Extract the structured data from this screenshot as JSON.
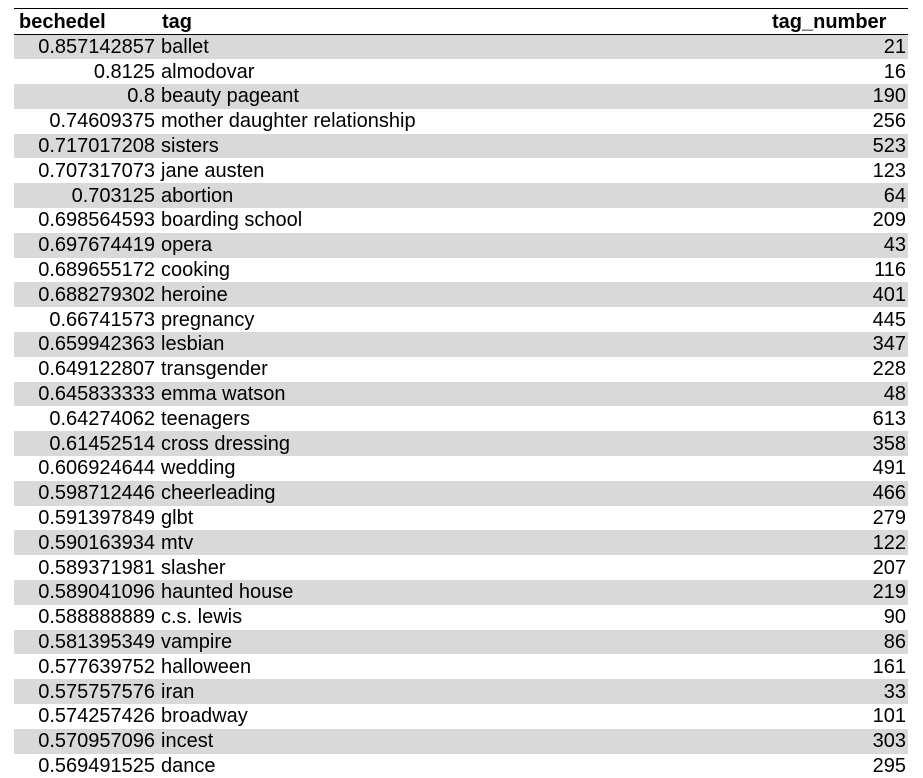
{
  "columns": {
    "bechedel": "bechedel",
    "tag": "tag",
    "tag_number": "tag_number"
  },
  "rows": [
    {
      "bechedel": "0.857142857",
      "tag": "ballet",
      "tag_number": "21"
    },
    {
      "bechedel": "0.8125",
      "tag": "almodovar",
      "tag_number": "16"
    },
    {
      "bechedel": "0.8",
      "tag": "beauty pageant",
      "tag_number": "190"
    },
    {
      "bechedel": "0.74609375",
      "tag": "mother daughter relationship",
      "tag_number": "256"
    },
    {
      "bechedel": "0.717017208",
      "tag": "sisters",
      "tag_number": "523"
    },
    {
      "bechedel": "0.707317073",
      "tag": "jane austen",
      "tag_number": "123"
    },
    {
      "bechedel": "0.703125",
      "tag": "abortion",
      "tag_number": "64"
    },
    {
      "bechedel": "0.698564593",
      "tag": "boarding school",
      "tag_number": "209"
    },
    {
      "bechedel": "0.697674419",
      "tag": "opera",
      "tag_number": "43"
    },
    {
      "bechedel": "0.689655172",
      "tag": "cooking",
      "tag_number": "116"
    },
    {
      "bechedel": "0.688279302",
      "tag": "heroine",
      "tag_number": "401"
    },
    {
      "bechedel": "0.66741573",
      "tag": "pregnancy",
      "tag_number": "445"
    },
    {
      "bechedel": "0.659942363",
      "tag": "lesbian",
      "tag_number": "347"
    },
    {
      "bechedel": "0.649122807",
      "tag": "transgender",
      "tag_number": "228"
    },
    {
      "bechedel": "0.645833333",
      "tag": "emma watson",
      "tag_number": "48"
    },
    {
      "bechedel": "0.64274062",
      "tag": "teenagers",
      "tag_number": "613"
    },
    {
      "bechedel": "0.61452514",
      "tag": "cross dressing",
      "tag_number": "358"
    },
    {
      "bechedel": "0.606924644",
      "tag": "wedding",
      "tag_number": "491"
    },
    {
      "bechedel": "0.598712446",
      "tag": "cheerleading",
      "tag_number": "466"
    },
    {
      "bechedel": "0.591397849",
      "tag": "glbt",
      "tag_number": "279"
    },
    {
      "bechedel": "0.590163934",
      "tag": "mtv",
      "tag_number": "122"
    },
    {
      "bechedel": "0.589371981",
      "tag": "slasher",
      "tag_number": "207"
    },
    {
      "bechedel": "0.589041096",
      "tag": "haunted house",
      "tag_number": "219"
    },
    {
      "bechedel": "0.588888889",
      "tag": "c.s. lewis",
      "tag_number": "90"
    },
    {
      "bechedel": "0.581395349",
      "tag": "vampire",
      "tag_number": "86"
    },
    {
      "bechedel": "0.577639752",
      "tag": "halloween",
      "tag_number": "161"
    },
    {
      "bechedel": "0.575757576",
      "tag": "iran",
      "tag_number": "33"
    },
    {
      "bechedel": "0.574257426",
      "tag": "broadway",
      "tag_number": "101"
    },
    {
      "bechedel": "0.570957096",
      "tag": "incest",
      "tag_number": "303"
    },
    {
      "bechedel": "0.569491525",
      "tag": "dance",
      "tag_number": "295"
    }
  ],
  "colors": {
    "band": "#d9d9d9",
    "background": "#ffffff",
    "rule": "#000000"
  }
}
